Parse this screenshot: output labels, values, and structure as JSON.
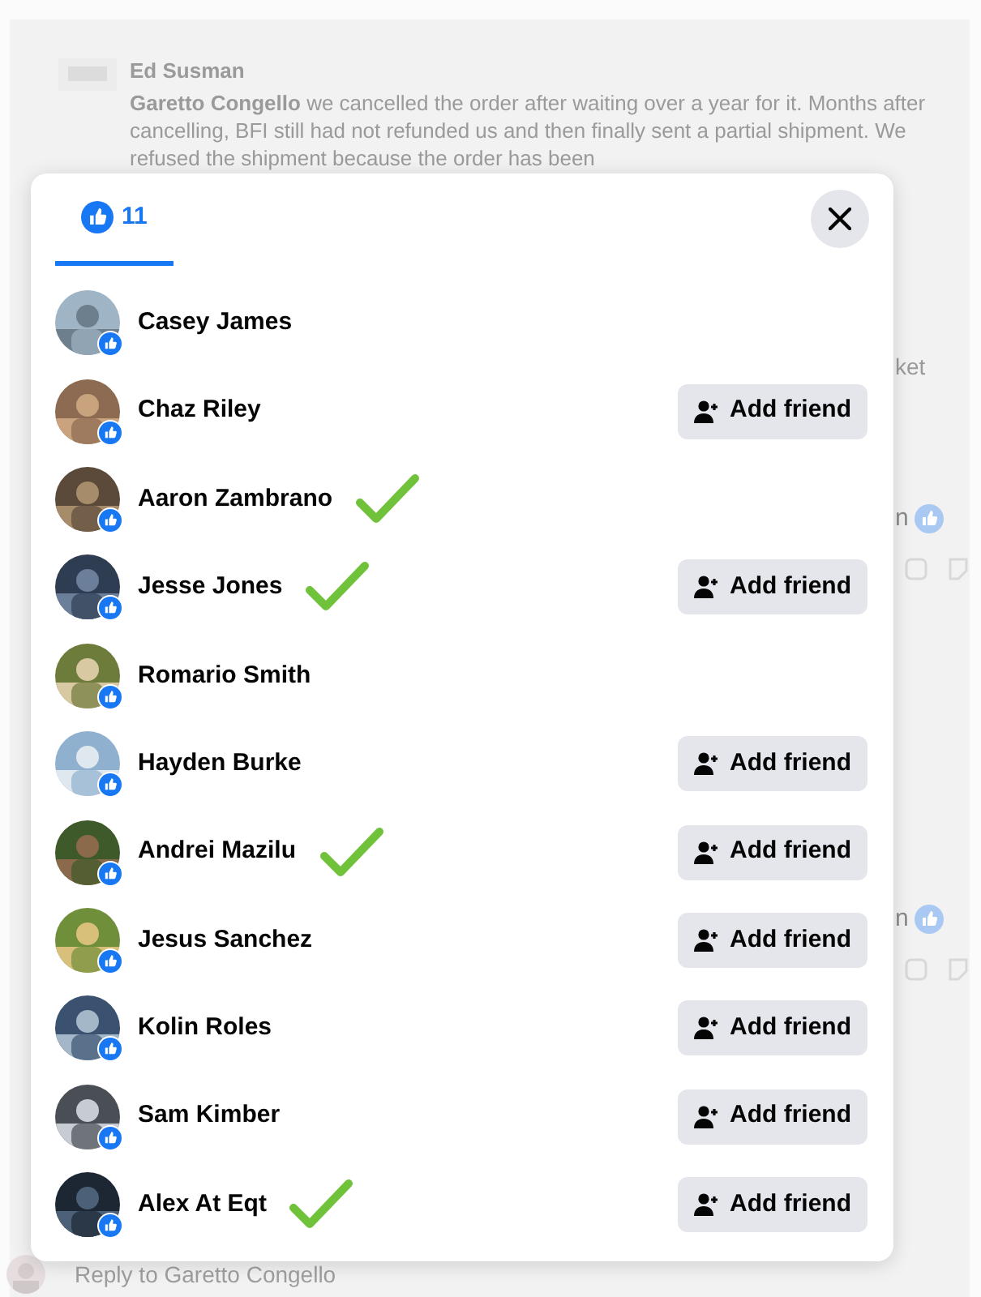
{
  "background": {
    "author": "Ed Susman",
    "comment": "**Garetto Congello** we cancelled the order after waiting over a year for it. Months after cancelling, BFI still had not refunded us and then finally sent a partial shipment. We refused the shipment because the order has been",
    "fragments": [
      "ket",
      "n",
      "n"
    ],
    "reply_placeholder": "Reply to Garetto Congello"
  },
  "reactions_dialog": {
    "tabs": [
      {
        "label": "11",
        "selected": true
      }
    ],
    "people": [
      {
        "name": "Casey James",
        "checked": false
      },
      {
        "name": "Chaz Riley",
        "checked": false,
        "button": "Add friend"
      },
      {
        "name": "Aaron Zambrano",
        "checked": true
      },
      {
        "name": "Jesse Jones",
        "checked": true,
        "button": "Add friend"
      },
      {
        "name": "Romario Smith",
        "checked": false
      },
      {
        "name": "Hayden Burke",
        "checked": false,
        "button": "Add friend"
      },
      {
        "name": "Andrei Mazilu",
        "checked": true,
        "button": "Add friend"
      },
      {
        "name": "Jesus Sanchez",
        "checked": false,
        "button": "Add friend"
      },
      {
        "name": "Kolin Roles",
        "checked": false,
        "button": "Add friend"
      },
      {
        "name": "Sam Kimber",
        "checked": false,
        "button": "Add friend"
      },
      {
        "name": "Alex At Eqt",
        "checked": true,
        "button": "Add friend"
      }
    ]
  }
}
